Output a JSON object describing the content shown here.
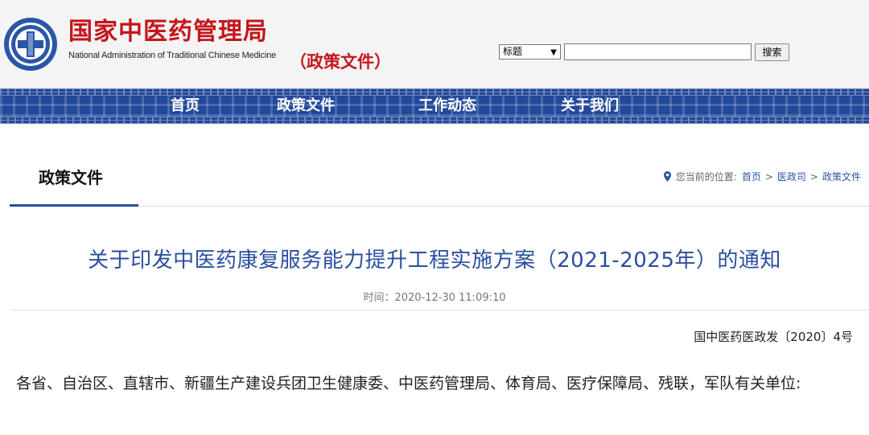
{
  "header": {
    "site_title": "国家中医药管理局",
    "site_subtitle": "National Administration of Traditional Chinese Medicine",
    "section_tag": "（政策文件）",
    "search": {
      "field_selected": "标题",
      "input_value": "",
      "button_label": "搜索"
    }
  },
  "nav": {
    "items": [
      {
        "label": "首页"
      },
      {
        "label": "政策文件"
      },
      {
        "label": "工作动态"
      },
      {
        "label": "关于我们"
      }
    ]
  },
  "column": {
    "title": "政策文件"
  },
  "breadcrumb": {
    "prefix": "您当前的位置:",
    "items": [
      {
        "label": "首页"
      },
      {
        "label": "医政司"
      },
      {
        "label": "政策文件"
      }
    ],
    "separator": ">"
  },
  "article": {
    "title": "关于印发中医药康复服务能力提升工程实施方案（2021-2025年）的通知",
    "meta": "时间：2020-12-30 11:09:10",
    "doc_number": "国中医药医政发〔2020〕4号",
    "recipients": "各省、自治区、直辖市、新疆生产建设兵团卫生健康委、中医药管理局、体育局、医疗保障局、残联，军队有关单位:"
  },
  "colors": {
    "brand_red": "#c4161c",
    "nav_blue": "#22489a",
    "title_blue": "#2a4f9e",
    "link_blue": "#2a56a8"
  },
  "icons": [
    "emblem-logo",
    "chevron-down-icon",
    "location-pin-icon"
  ]
}
